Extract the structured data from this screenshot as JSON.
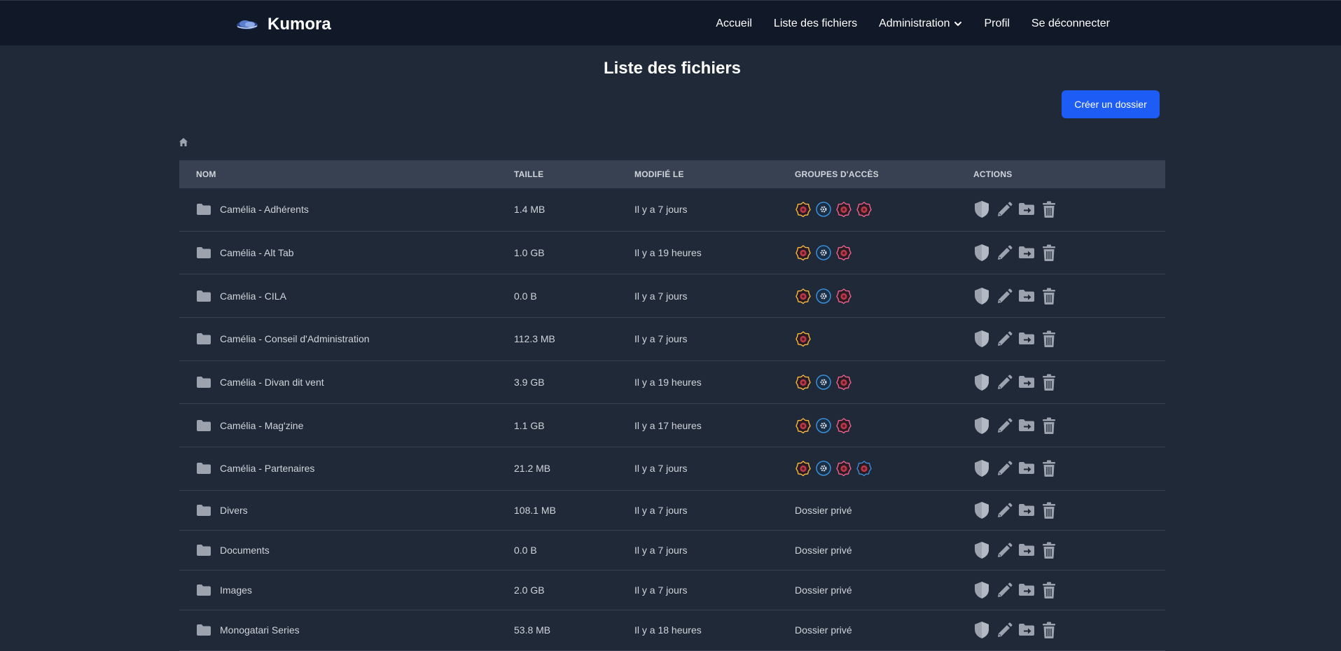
{
  "app": {
    "name": "Kumora"
  },
  "nav": {
    "home": "Accueil",
    "files": "Liste des fichiers",
    "admin": "Administration",
    "profile": "Profil",
    "logout": "Se déconnecter"
  },
  "page": {
    "title": "Liste des fichiers",
    "create_folder": "Créer un dossier"
  },
  "table": {
    "headers": {
      "name": "NOM",
      "size": "TAILLE",
      "modified": "MODIFIÉ LE",
      "groups": "GROUPES D'ACCÈS",
      "actions": "ACTIONS"
    },
    "rows": [
      {
        "name": "Camélia - Adhérents",
        "size": "1.4 MB",
        "modified": "Il y a 7 jours",
        "groups": [
          "yellow",
          "blue-gear",
          "pink",
          "pink"
        ]
      },
      {
        "name": "Camélia - Alt Tab",
        "size": "1.0 GB",
        "modified": "Il y a 19 heures",
        "groups": [
          "yellow",
          "blue-gear",
          "pink"
        ]
      },
      {
        "name": "Camélia - CILA",
        "size": "0.0 B",
        "modified": "Il y a 7 jours",
        "groups": [
          "yellow",
          "blue-gear",
          "pink"
        ]
      },
      {
        "name": "Camélia - Conseil d'Administration",
        "size": "112.3 MB",
        "modified": "Il y a 7 jours",
        "groups": [
          "yellow"
        ]
      },
      {
        "name": "Camélia - Divan dit vent",
        "size": "3.9 GB",
        "modified": "Il y a 19 heures",
        "groups": [
          "yellow",
          "blue-gear",
          "pink"
        ]
      },
      {
        "name": "Camélia - Mag'zine",
        "size": "1.1 GB",
        "modified": "Il y a 17 heures",
        "groups": [
          "yellow",
          "blue-gear",
          "pink"
        ]
      },
      {
        "name": "Camélia - Partenaires",
        "size": "21.2 MB",
        "modified": "Il y a 7 jours",
        "groups": [
          "yellow",
          "blue-gear",
          "pink",
          "blue"
        ]
      },
      {
        "name": "Divers",
        "size": "108.1 MB",
        "modified": "Il y a 7 jours",
        "private": "Dossier privé"
      },
      {
        "name": "Documents",
        "size": "0.0 B",
        "modified": "Il y a 7 jours",
        "private": "Dossier privé"
      },
      {
        "name": "Images",
        "size": "2.0 GB",
        "modified": "Il y a 7 jours",
        "private": "Dossier privé"
      },
      {
        "name": "Monogatari Series",
        "size": "53.8 MB",
        "modified": "Il y a 18 heures",
        "private": "Dossier privé"
      }
    ]
  },
  "icons": {
    "folder": "folder-icon",
    "home": "home-icon",
    "permissions": "shield-icon",
    "rename": "pencil-icon",
    "move": "folder-move-icon",
    "delete": "trash-icon"
  },
  "colors": {
    "accent": "#1d5cf5",
    "group_yellow": "#f5b942",
    "group_pink": "#f06292",
    "group_blue": "#3b8fd9"
  }
}
